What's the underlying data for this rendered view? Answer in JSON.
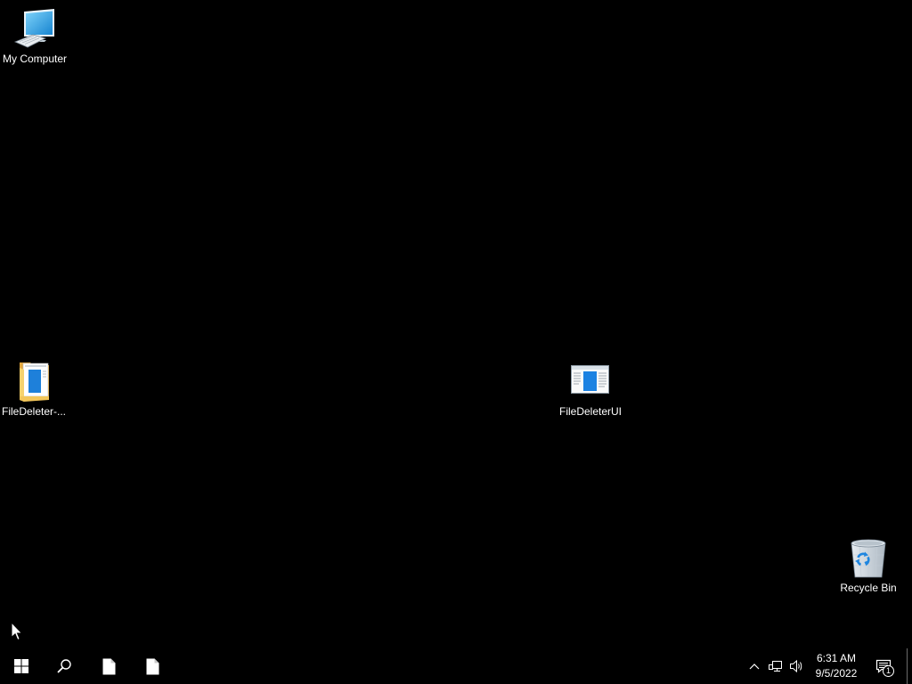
{
  "desktop": {
    "background_color": "#000000",
    "icons": [
      {
        "label": "My Computer",
        "icon": "computer-icon"
      },
      {
        "label": "FileDeleter-...",
        "icon": "folder-icon"
      },
      {
        "label": "FileDeleterUI",
        "icon": "application-window-icon"
      },
      {
        "label": "Recycle Bin",
        "icon": "recycle-bin-icon"
      }
    ]
  },
  "cursor": {
    "icon": "mouse-pointer-icon"
  },
  "taskbar": {
    "background_color": "#000000",
    "start": {
      "icon": "windows-logo-icon"
    },
    "search": {
      "icon": "search-icon"
    },
    "pinned": [
      {
        "icon": "document-icon"
      },
      {
        "icon": "document-icon"
      }
    ],
    "tray": {
      "overflow_icon": "chevron-up-icon",
      "network_icon": "network-icon",
      "volume_icon": "volume-icon",
      "clock": {
        "time": "6:31 AM",
        "date": "9/5/2022"
      },
      "action_center": {
        "icon": "notification-icon",
        "badge_count": "1"
      }
    }
  },
  "colors": {
    "accent": "#1e82dc",
    "label_text": "#ffffff"
  }
}
